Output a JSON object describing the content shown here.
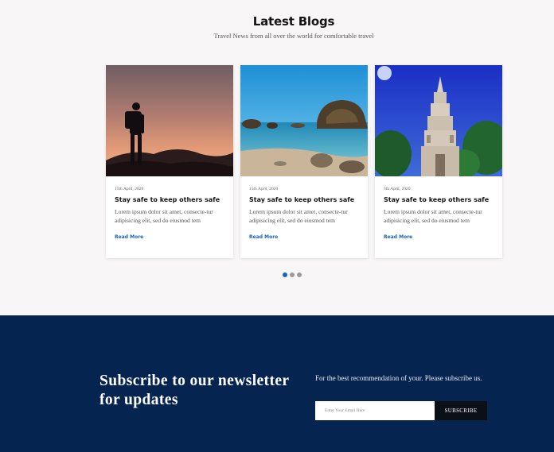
{
  "blogs": {
    "title": "Latest Blogs",
    "subtitle": "Travel News from all over the world for comfortable travel",
    "cards": [
      {
        "image": "hiker-silhouette-sunset",
        "date": "15th April, 2020",
        "title": "Stay safe to keep others safe",
        "excerpt": "Lorem ipsum dolor sit amet, consecte-tur adipisicing elit, sed do eiusmod tem",
        "read_more": "Read More"
      },
      {
        "image": "rocky-beach-coast",
        "date": "15th April, 2020",
        "title": "Stay safe to keep others safe",
        "excerpt": "Lorem ipsum dolor sit amet, consecte-tur adipisicing elit, sed do eiusmod tem",
        "read_more": "Read More"
      },
      {
        "image": "temple-tower-trees",
        "date": "5th April, 2020",
        "title": "Stay safe to keep others safe",
        "excerpt": "Lorem ipsum dolor sit amet, consecte-tur adipisicing elit, sed do eiusmod tem",
        "read_more": "Read More"
      }
    ],
    "pagination": {
      "pages": 3,
      "active": 1
    }
  },
  "newsletter": {
    "heading": "Subscribe to our newsletter for updates",
    "text": "For the best recommendation of your. Please subscribe us.",
    "input_placeholder": "Enter Your Email Here",
    "button_label": "SUBSCRIBE"
  },
  "colors": {
    "page_bg": "#f8f6f7",
    "newsletter_bg": "#062450",
    "link": "#1b63b4",
    "dot_active": "#1565c0",
    "button_bg": "#0b0f16"
  }
}
